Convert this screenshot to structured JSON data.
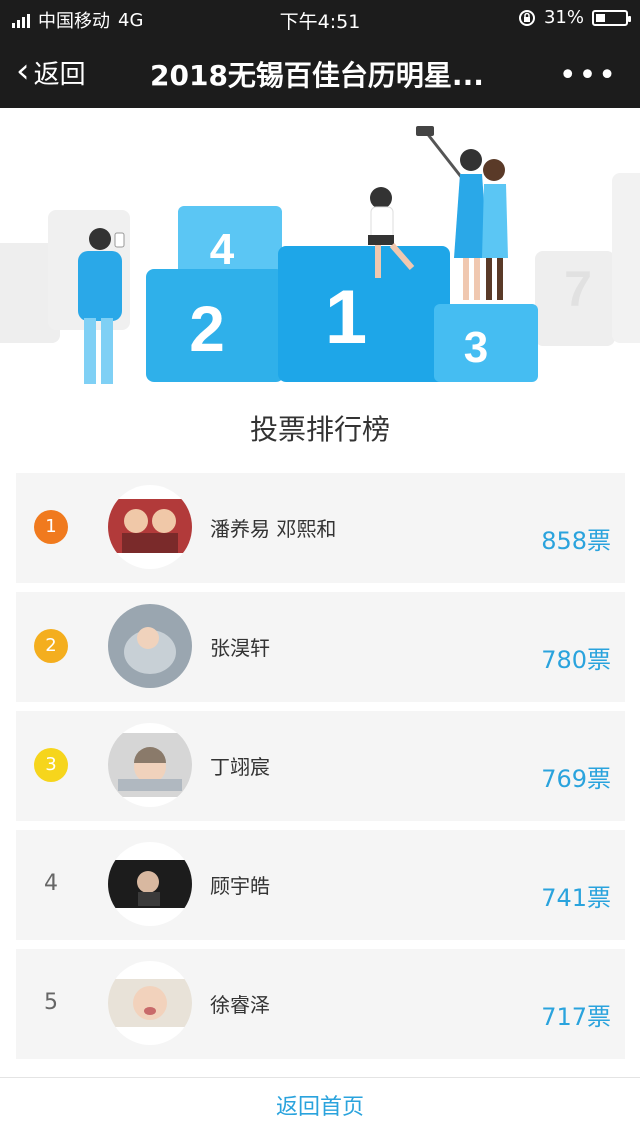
{
  "status_bar": {
    "carrier": "中国移动",
    "network": "4G",
    "time": "下午4:51",
    "battery_percent": "31%",
    "battery_level": 0.31
  },
  "nav": {
    "back_label": "返回",
    "title": "2018无锡百佳台历明星...",
    "more_label": "•••"
  },
  "podium": {
    "first": "1",
    "second": "2",
    "third": "3",
    "fourth": "4",
    "fifth": "7"
  },
  "ranking_title": "投票排行榜",
  "rank_colors": {
    "1": "#f07a1e",
    "2": "#f4ae1e",
    "3": "#f6d51c"
  },
  "entries": [
    {
      "rank": "1",
      "name": "潘养易 邓熙和",
      "votes": "858票"
    },
    {
      "rank": "2",
      "name": "张淏轩",
      "votes": "780票"
    },
    {
      "rank": "3",
      "name": "丁翊宸",
      "votes": "769票"
    },
    {
      "rank": "4",
      "name": "顾宇皓",
      "votes": "741票"
    },
    {
      "rank": "5",
      "name": "徐睿泽",
      "votes": "717票"
    }
  ],
  "footer": {
    "home_label": "返回首页"
  }
}
